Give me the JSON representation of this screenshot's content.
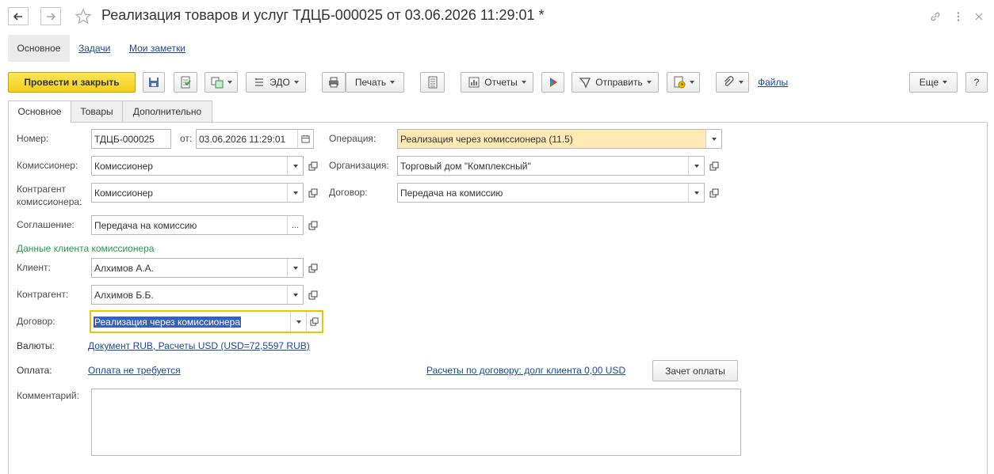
{
  "window": {
    "title": "Реализация товаров и услуг ТДЦБ-000025 от 03.06.2026 11:29:01 *",
    "icons": [
      "back-arrow-icon",
      "forward-arrow-icon",
      "star-icon",
      "link-icon",
      "more-vertical-icon",
      "close-icon"
    ]
  },
  "subnav": {
    "main": "Основное",
    "tasks": "Задачи",
    "notes": "Мои заметки"
  },
  "toolbar": {
    "post_and_close": "Провести и закрыть",
    "edo": "ЭДО",
    "print": "Печать",
    "reports": "Отчеты",
    "send": "Отправить",
    "files": "Файлы",
    "more": "Еще",
    "help": "?"
  },
  "tabs": [
    "Основное",
    "Товары",
    "Дополнительно"
  ],
  "form": {
    "number_label": "Номер:",
    "number_value": "ТДЦБ-000025",
    "date_label": "от:",
    "date_value": "03.06.2026 11:29:01",
    "operation_label": "Операция:",
    "operation_value": "Реализация через комиссионера (11.5)",
    "commissioner_label": "Комиссионер:",
    "commissioner_value": "Комиссионер",
    "organization_label": "Организация:",
    "organization_value": "Торговый дом \"Комплексный\"",
    "counterparty_comm_label_1": "Контрагент",
    "counterparty_comm_label_2": "комиссионера:",
    "counterparty_comm_value": "Комиссионер",
    "contract_label": "Договор:",
    "contract_value": "Передача на комиссию",
    "agreement_label": "Соглашение:",
    "agreement_value": "Передача на комиссию",
    "client_section": "Данные клиента комиссионера",
    "client_label": "Клиент:",
    "client_value": "Алхимов А.А.",
    "counterparty_label": "Контрагент:",
    "counterparty_value": "Алхимов Б.Б.",
    "client_contract_label": "Договор:",
    "client_contract_value": "Реализация через комиссионера",
    "currency_label": "Валюты:",
    "currency_link": "Документ RUB, Расчеты USD (USD=72,5597 RUB)",
    "payment_label": "Оплата:",
    "payment_link": "Оплата не требуется",
    "settlements_link": "Расчеты по договору: долг клиента 0,00 USD",
    "offset_button": "Зачет оплаты",
    "comment_label": "Комментарий:",
    "comment_value": ""
  },
  "colors": {
    "accent_yellow": "#f2cf19",
    "operation_bg": "#fde9b4",
    "link": "#1a4a9c",
    "section_green": "#2a9a4a",
    "selection": "#3a5fb8"
  }
}
